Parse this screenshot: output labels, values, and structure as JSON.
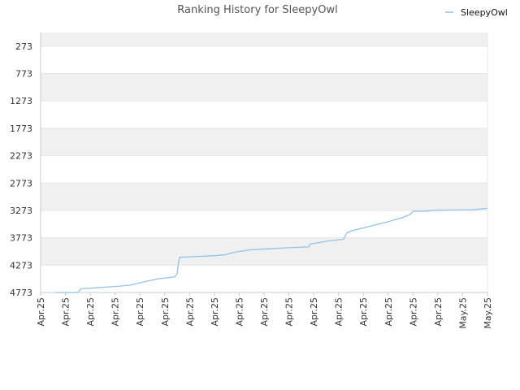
{
  "chart_data": {
    "type": "line",
    "title": "Ranking History for SleepyOwl",
    "xlabel": "",
    "ylabel": "",
    "y_inverted": true,
    "ylim": [
      4773,
      23
    ],
    "y_ticks": [
      273,
      773,
      1273,
      1773,
      2273,
      2773,
      3273,
      3773,
      4273,
      4773
    ],
    "x_tick_labels": [
      "Apr.25",
      "Apr.25",
      "Apr.25",
      "Apr.25",
      "Apr.25",
      "Apr.25",
      "Apr.25",
      "Apr.25",
      "Apr.25",
      "Apr.25",
      "Apr.25",
      "Apr.25",
      "Apr.25",
      "Apr.25",
      "Apr.25",
      "Apr.25",
      "Apr.25",
      "May.25",
      "May.25"
    ],
    "grid": true,
    "legend_position": "top-right",
    "colors": {
      "series": "#90c4ec",
      "band": "#f0f0f0",
      "grid": "#e6e6e6",
      "axis": "#cccccc"
    },
    "series": [
      {
        "name": "SleepyOwl",
        "x": [
          0.6,
          1.5,
          1.6,
          1.7,
          2.0,
          2.6,
          3.2,
          3.6,
          4.2,
          4.7,
          5.4,
          5.5,
          5.55,
          5.6,
          6.0,
          6.6,
          7.0,
          7.4,
          7.9,
          8.5,
          9.2,
          10.0,
          10.8,
          10.85,
          11.6,
          12.2,
          12.3,
          12.35,
          12.5,
          13.2,
          14.0,
          14.6,
          14.9,
          15.0,
          15.5,
          16.0,
          16.3,
          16.8,
          17.4,
          18.0
        ],
        "y": [
          4773,
          4773,
          4715,
          4700,
          4695,
          4675,
          4655,
          4640,
          4575,
          4525,
          4490,
          4425,
          4225,
          4130,
          4120,
          4110,
          4100,
          4085,
          4030,
          3990,
          3975,
          3955,
          3940,
          3890,
          3830,
          3800,
          3710,
          3680,
          3650,
          3570,
          3480,
          3400,
          3340,
          3290,
          3285,
          3270,
          3270,
          3265,
          3260,
          3235
        ]
      }
    ]
  }
}
